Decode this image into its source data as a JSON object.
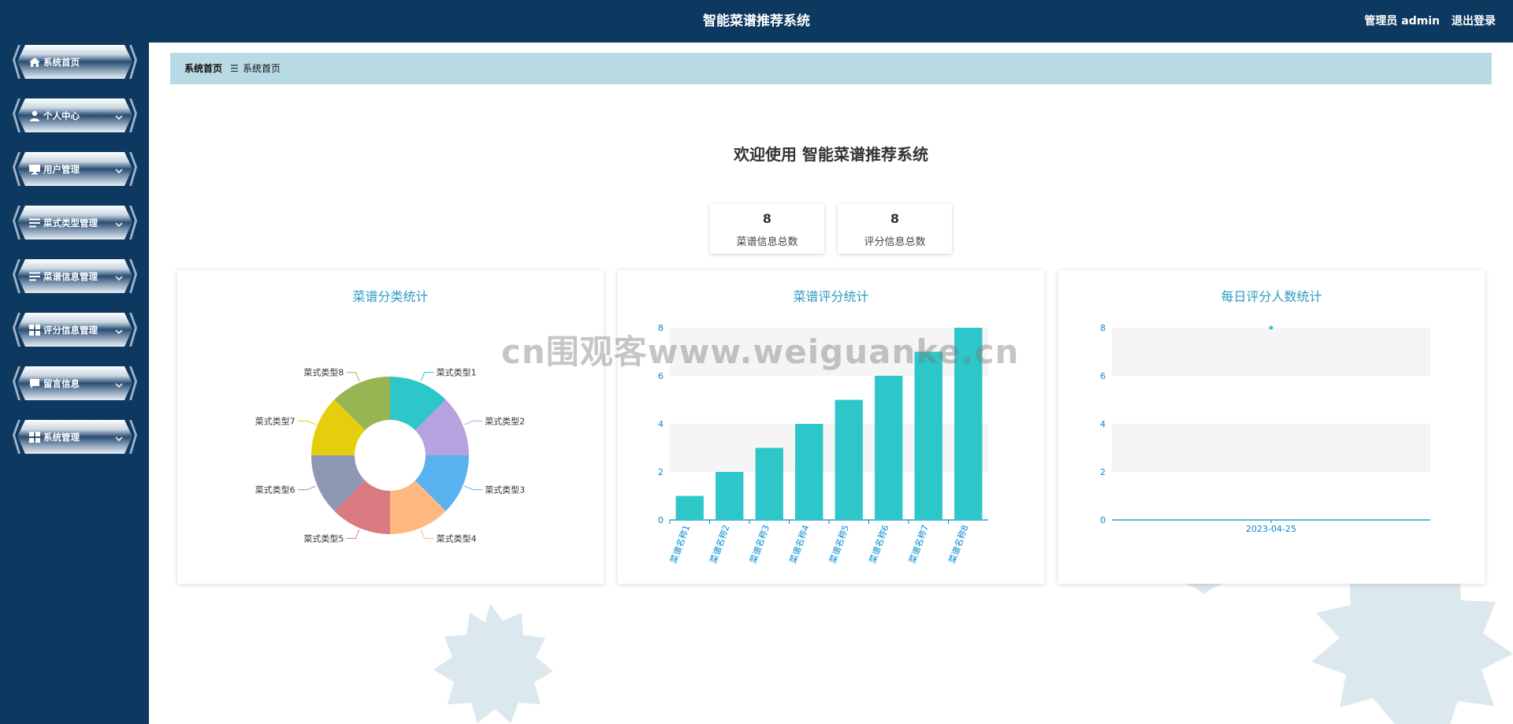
{
  "header": {
    "title": "智能菜谱推荐系统",
    "user_label": "管理员 admin",
    "logout_label": "退出登录"
  },
  "sidebar": {
    "items": [
      {
        "label": "系统首页",
        "icon": "home-icon",
        "expandable": false
      },
      {
        "label": "个人中心",
        "icon": "user-icon",
        "expandable": true
      },
      {
        "label": "用户管理",
        "icon": "monitor-icon",
        "expandable": true
      },
      {
        "label": "菜式类型管理",
        "icon": "list-icon",
        "expandable": true
      },
      {
        "label": "菜谱信息管理",
        "icon": "list-icon",
        "expandable": true
      },
      {
        "label": "评分信息管理",
        "icon": "grid-icon",
        "expandable": true
      },
      {
        "label": "留言信息",
        "icon": "message-icon",
        "expandable": true
      },
      {
        "label": "系统管理",
        "icon": "grid-icon",
        "expandable": true
      }
    ]
  },
  "breadcrumb": {
    "root": "系统首页",
    "separator": "☰",
    "current": "系统首页"
  },
  "welcome": "欢迎使用 智能菜谱推荐系统",
  "stats": [
    {
      "value": "8",
      "label": "菜谱信息总数"
    },
    {
      "value": "8",
      "label": "评分信息总数"
    }
  ],
  "charts": {
    "pie_title": "菜谱分类统计",
    "bar_title": "菜谱评分统计",
    "line_title": "每日评分人数统计"
  },
  "watermark": "cn围观客www.weiguanke.cn",
  "colors": {
    "header_bg": "#0d3860",
    "breadcrumb_bg": "#b8dae4",
    "bar": "#2ec7c9",
    "title_accent": "#2c9bc3"
  },
  "chart_data": [
    {
      "type": "pie",
      "title": "菜谱分类统计",
      "donut": true,
      "categories": [
        "菜式类型1",
        "菜式类型2",
        "菜式类型3",
        "菜式类型4",
        "菜式类型5",
        "菜式类型6",
        "菜式类型7",
        "菜式类型8"
      ],
      "values": [
        1,
        1,
        1,
        1,
        1,
        1,
        1,
        1
      ],
      "colors": [
        "#2ec7c9",
        "#b6a2de",
        "#5ab1ef",
        "#ffb980",
        "#d87a80",
        "#8d98b3",
        "#e5cf0d",
        "#97b552"
      ]
    },
    {
      "type": "bar",
      "title": "菜谱评分统计",
      "categories": [
        "菜谱名称1",
        "菜谱名称2",
        "菜谱名称3",
        "菜谱名称4",
        "菜谱名称5",
        "菜谱名称6",
        "菜谱名称7",
        "菜谱名称8"
      ],
      "values": [
        1,
        2,
        3,
        4,
        5,
        6,
        7,
        8
      ],
      "ylim": [
        0,
        8
      ],
      "yticks": [
        0,
        2,
        4,
        6,
        8
      ],
      "color": "#2ec7c9"
    },
    {
      "type": "scatter",
      "title": "每日评分人数统计",
      "x": [
        "2023-04-25"
      ],
      "values": [
        8
      ],
      "ylim": [
        0,
        8
      ],
      "yticks": [
        0,
        2,
        4,
        6,
        8
      ],
      "color": "#2ec7c9"
    }
  ]
}
